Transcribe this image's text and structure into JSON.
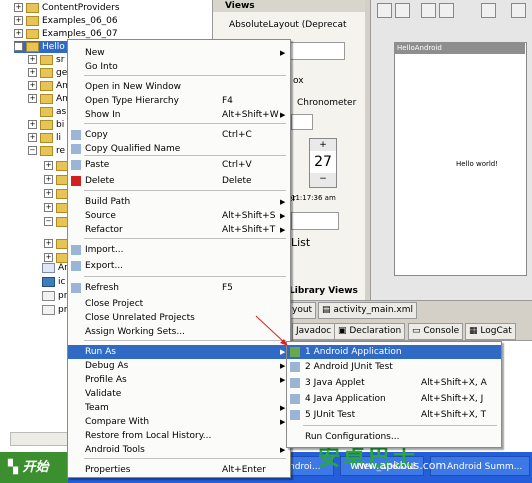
{
  "explorer": {
    "rows": [
      {
        "label": "ContentProviders"
      },
      {
        "label": "Examples_06_06"
      },
      {
        "label": "Examples_06_07"
      },
      {
        "label": "Hello"
      },
      {
        "label": "sr"
      },
      {
        "label": "ge"
      },
      {
        "label": "An"
      },
      {
        "label": "An"
      },
      {
        "label": "as"
      },
      {
        "label": "bi"
      },
      {
        "label": "li"
      },
      {
        "label": "re"
      },
      {
        "label": "An"
      },
      {
        "label": "ic"
      },
      {
        "label": "pr"
      },
      {
        "label": "pr"
      }
    ]
  },
  "views": {
    "title": "Views",
    "absolute_layout": "AbsoluteLayout (Deprecat",
    "box_fragment": "ox",
    "chronometer": "Chronometer",
    "stepper_value": "27",
    "time_text": "11:17:36 am",
    "fragment_er": "er",
    "list_label": "List",
    "library_views": "Library Views"
  },
  "preview": {
    "app_title": "HelloAndroid",
    "hello_text": "Hello world!"
  },
  "editor_tabs": {
    "layout_tab": "yout",
    "file_tab": "activity_main.xml"
  },
  "console_tabs": [
    "Javadoc",
    "Declaration",
    "Console",
    "LogCat"
  ],
  "context_menu": {
    "items": [
      {
        "label": "New",
        "shortcut": "",
        "submenu": true
      },
      {
        "label": "Go Into",
        "shortcut": ""
      },
      {
        "label": "Open in New Window",
        "shortcut": ""
      },
      {
        "label": "Open Type Hierarchy",
        "shortcut": "F4"
      },
      {
        "label": "Show In",
        "shortcut": "Alt+Shift+W",
        "submenu": true
      },
      {
        "label": "Copy",
        "shortcut": "Ctrl+C",
        "icon": "copy-icon"
      },
      {
        "label": "Copy Qualified Name",
        "shortcut": "",
        "icon": "copy-qualified-icon"
      },
      {
        "label": "Paste",
        "shortcut": "Ctrl+V",
        "icon": "paste-icon"
      },
      {
        "label": "Delete",
        "shortcut": "Delete",
        "icon": "delete-icon"
      },
      {
        "label": "Build Path",
        "shortcut": "",
        "submenu": true
      },
      {
        "label": "Source",
        "shortcut": "Alt+Shift+S",
        "submenu": true
      },
      {
        "label": "Refactor",
        "shortcut": "Alt+Shift+T",
        "submenu": true
      },
      {
        "label": "Import...",
        "shortcut": "",
        "icon": "import-icon"
      },
      {
        "label": "Export...",
        "shortcut": "",
        "icon": "export-icon"
      },
      {
        "label": "Refresh",
        "shortcut": "F5",
        "icon": "refresh-icon"
      },
      {
        "label": "Close Project",
        "shortcut": ""
      },
      {
        "label": "Close Unrelated Projects",
        "shortcut": ""
      },
      {
        "label": "Assign Working Sets...",
        "shortcut": ""
      },
      {
        "label": "Run As",
        "shortcut": "",
        "submenu": true,
        "highlighted": true
      },
      {
        "label": "Debug As",
        "shortcut": "",
        "submenu": true
      },
      {
        "label": "Profile As",
        "shortcut": "",
        "submenu": true
      },
      {
        "label": "Validate",
        "shortcut": ""
      },
      {
        "label": "Team",
        "shortcut": "",
        "submenu": true
      },
      {
        "label": "Compare With",
        "shortcut": "",
        "submenu": true
      },
      {
        "label": "Restore from Local History...",
        "shortcut": ""
      },
      {
        "label": "Android Tools",
        "shortcut": "",
        "submenu": true
      },
      {
        "label": "Properties",
        "shortcut": "Alt+Enter"
      }
    ]
  },
  "run_as_menu": {
    "items": [
      {
        "label": "1 Android Application",
        "shortcut": "",
        "icon": "android-app-icon",
        "highlighted": true
      },
      {
        "label": "2 Android JUnit Test",
        "shortcut": "",
        "icon": "junit-icon"
      },
      {
        "label": "3 Java Applet",
        "shortcut": "Alt+Shift+X, A",
        "icon": "applet-icon"
      },
      {
        "label": "4 Java Application",
        "shortcut": "Alt+Shift+X, J",
        "icon": "java-app-icon"
      },
      {
        "label": "5 JUnit Test",
        "shortcut": "Alt+Shift+X, T",
        "icon": "junit-test-icon"
      },
      {
        "label": "Run Configurations...",
        "shortcut": ""
      }
    ]
  },
  "taskbar": {
    "start_label": "开始",
    "tasks": [
      "ndroi...",
      "New_android",
      "Android Summ..."
    ]
  },
  "watermark": {
    "brand": "安卓巴士",
    "url": "www.apkbus.com"
  },
  "colors": {
    "highlight": "#316ac5",
    "taskbar": "#245edb",
    "start_button": "#3c8f2e",
    "annotation_arrow": "#e02020"
  }
}
